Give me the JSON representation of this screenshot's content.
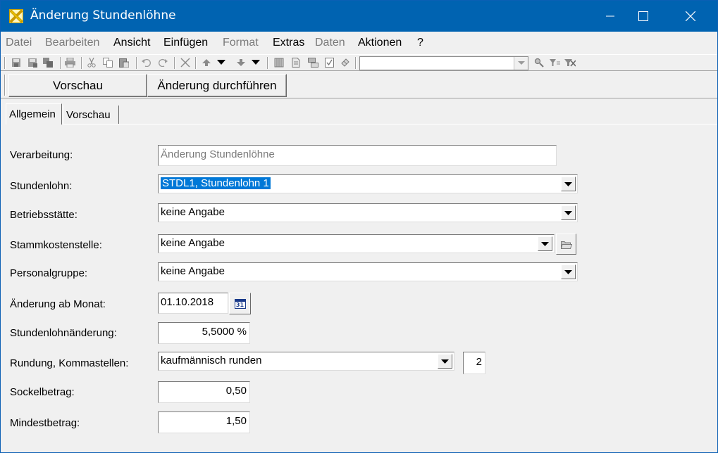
{
  "window": {
    "title": "Änderung Stundenlöhne",
    "icons": {
      "app": "app-x-icon",
      "minimize": "minimize-icon",
      "maximize": "maximize-icon",
      "close": "close-icon"
    }
  },
  "menu": {
    "items": [
      {
        "label": "Datei",
        "enabled": false
      },
      {
        "label": "Bearbeiten",
        "enabled": false
      },
      {
        "label": "Ansicht",
        "enabled": true
      },
      {
        "label": "Einfügen",
        "enabled": true
      },
      {
        "label": "Format",
        "enabled": false
      },
      {
        "label": "Extras",
        "enabled": true
      },
      {
        "label": "Daten",
        "enabled": false
      },
      {
        "label": "Aktionen",
        "enabled": true
      },
      {
        "label": "?",
        "enabled": true
      }
    ]
  },
  "toolbar": {
    "search_value": "",
    "icons": [
      "save-icon",
      "save-as-icon",
      "save-all-icon",
      "print-icon",
      "cut-icon",
      "copy-icon",
      "paste-icon",
      "undo-icon",
      "redo-icon",
      "delete-icon",
      "move-up-icon",
      "move-down-icon",
      "insert-column-icon",
      "document-icon",
      "merge-icon",
      "checklist-icon",
      "clear-icon",
      "search-icon",
      "filter-icon",
      "remove-filter-icon"
    ]
  },
  "actions": {
    "preview_label": "Vorschau",
    "apply_label": "Änderung durchführen"
  },
  "tabs": [
    {
      "label": "Allgemein",
      "active": true
    },
    {
      "label": "Vorschau",
      "active": false
    }
  ],
  "form": {
    "verarbeitung": {
      "label": "Verarbeitung:",
      "value": "Änderung Stundenlöhne"
    },
    "stundenlohn": {
      "label": "Stundenlohn:",
      "value": "STDL1, Stundenlohn 1"
    },
    "betriebsstaette": {
      "label": "Betriebsstätte:",
      "value": "keine Angabe"
    },
    "stammkostenstelle": {
      "label": "Stammkostenstelle:",
      "value": "keine Angabe"
    },
    "personalgruppe": {
      "label": "Personalgruppe:",
      "value": "keine Angabe"
    },
    "aenderung_ab": {
      "label": "Änderung ab Monat:",
      "value": "01.10.2018",
      "calendar_text": "31"
    },
    "stundenlohnaenderung": {
      "label": "Stundenlohnänderung:",
      "value": "5,5000 %"
    },
    "rundung": {
      "label": "Rundung, Kommastellen:",
      "value": "kaufmännisch runden",
      "kommastellen": "2"
    },
    "sockelbetrag": {
      "label": "Sockelbetrag:",
      "value": "0,50"
    },
    "mindestbetrag": {
      "label": "Mindestbetrag:",
      "value": "1,50"
    }
  }
}
